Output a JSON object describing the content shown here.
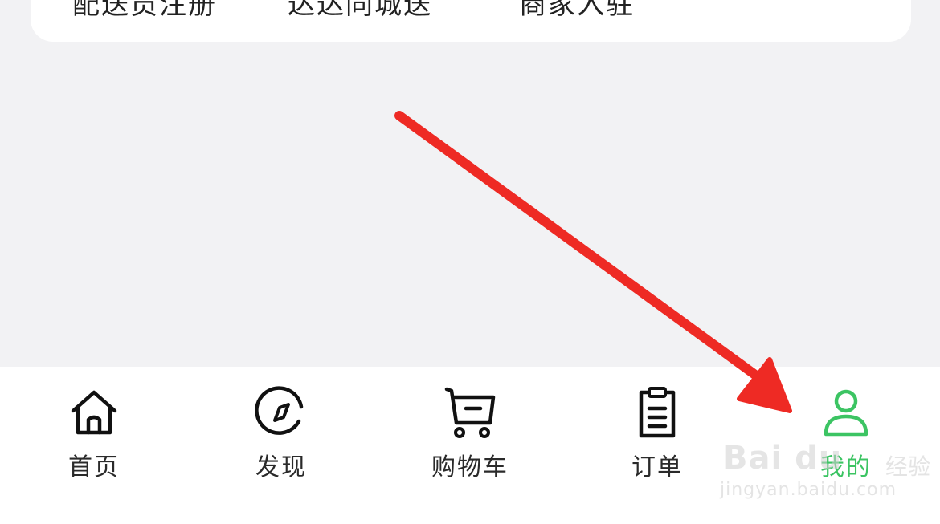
{
  "top_links": [
    {
      "label": "配送员注册"
    },
    {
      "label": "达达同城送"
    },
    {
      "label": "商家入驻"
    }
  ],
  "tabbar": {
    "active_color": "#3cc463",
    "items": [
      {
        "label": "首页",
        "icon": "home-icon"
      },
      {
        "label": "发现",
        "icon": "compass-icon"
      },
      {
        "label": "购物车",
        "icon": "cart-icon"
      },
      {
        "label": "订单",
        "icon": "clipboard-icon"
      },
      {
        "label": "我的",
        "icon": "user-icon",
        "active": true
      }
    ]
  },
  "annotation": {
    "type": "arrow",
    "color": "#ee2a24"
  },
  "watermark": {
    "brand": "Bai du",
    "product": "经验",
    "url": "jingyan.baidu.com"
  }
}
